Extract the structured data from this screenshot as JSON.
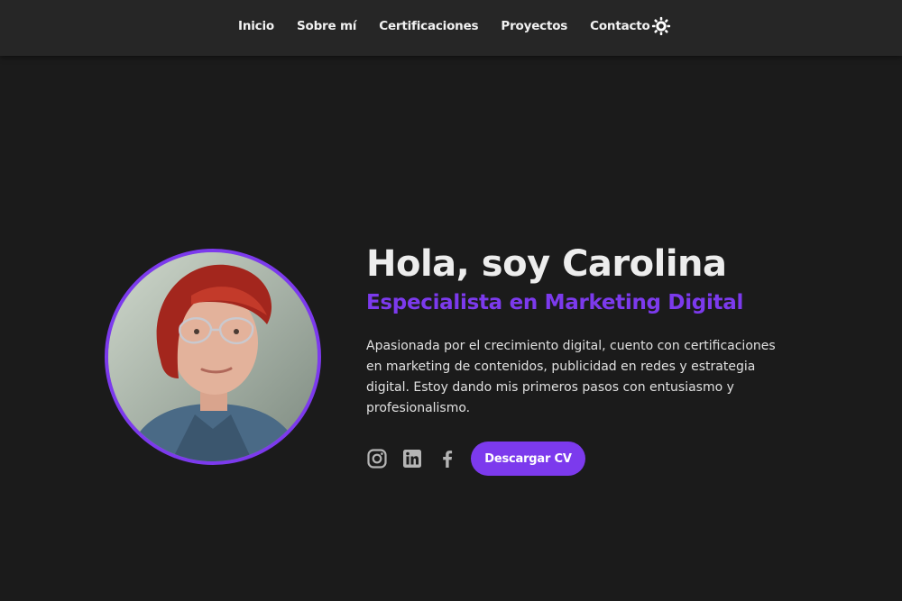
{
  "nav": {
    "items": [
      {
        "label": "Inicio"
      },
      {
        "label": "Sobre mí"
      },
      {
        "label": "Certificaciones"
      },
      {
        "label": "Proyectos"
      },
      {
        "label": "Contacto"
      }
    ],
    "theme_toggle_icon": "sun-icon"
  },
  "hero": {
    "title": "Hola, soy Carolina",
    "subtitle": "Especialista en Marketing Digital",
    "description": "Apasionada por el crecimiento digital, cuento con certificaciones en marketing de contenidos, publicidad en redes y estrategia digital. Estoy dando mis primeros pasos con entusiasmo y profesionalismo.",
    "avatar_icon": "profile-photo",
    "social": [
      {
        "icon": "instagram-icon"
      },
      {
        "icon": "linkedin-icon"
      },
      {
        "icon": "facebook-icon"
      }
    ],
    "cv_button_label": "Descargar CV"
  },
  "colors": {
    "background": "#1b1b1b",
    "navbar": "#262626",
    "accent": "#7c3aed",
    "text": "#ededed",
    "icon": "#b5b5b5"
  }
}
